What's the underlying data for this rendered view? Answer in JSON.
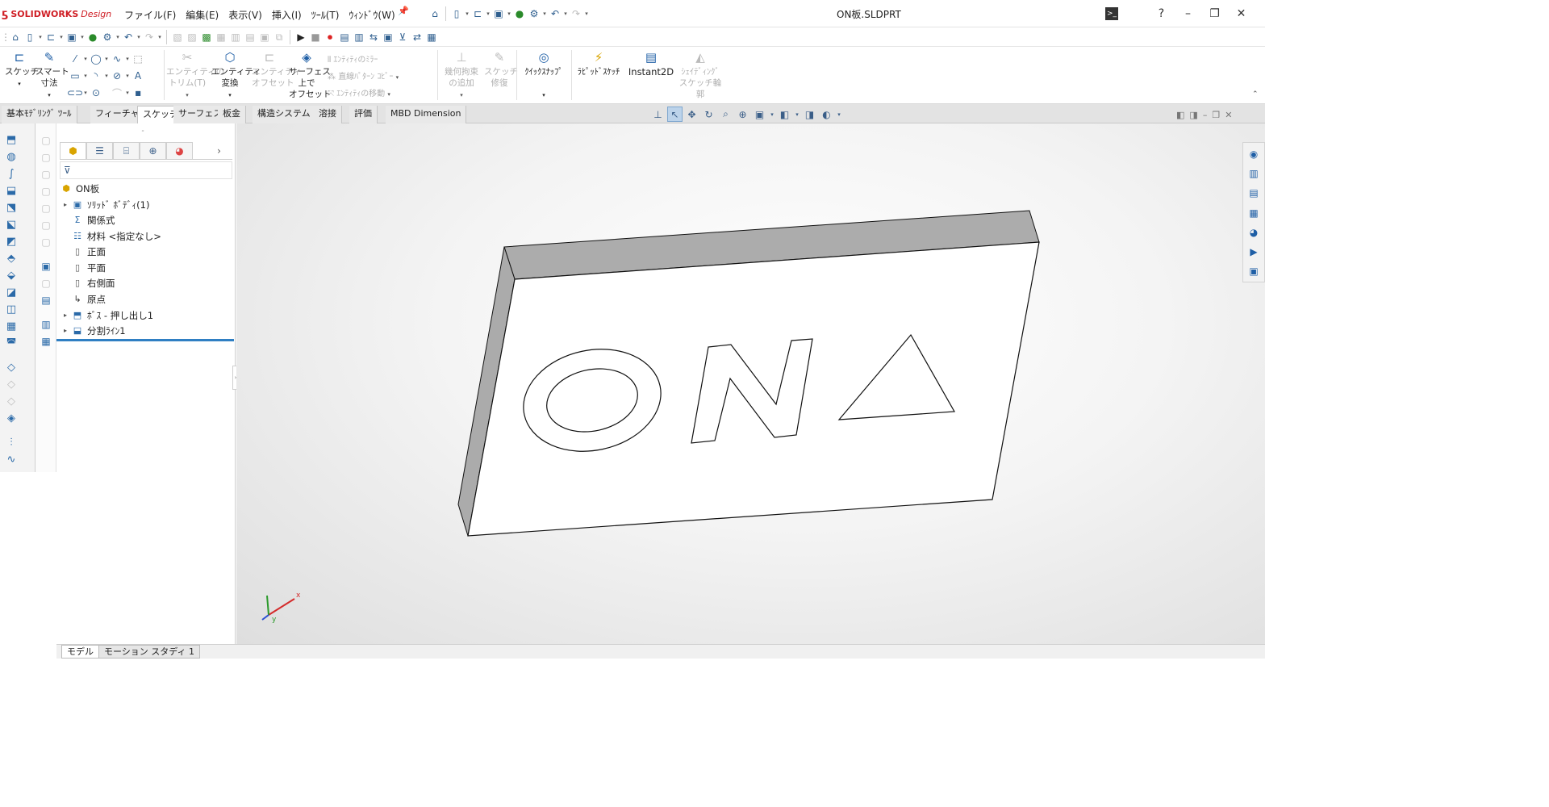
{
  "app": {
    "brand": "SOLIDWORKS",
    "brand_suffix": "Design",
    "doc_title": "ON板.SLDPRT"
  },
  "menus": [
    "ファイル(F)",
    "編集(E)",
    "表示(V)",
    "挿入(I)",
    "ﾂｰﾙ(T)",
    "ｳｨﾝﾄﾞｳ(W)"
  ],
  "ribbon": {
    "sketch": "スケッチ",
    "smart_dim_1": "スマート",
    "smart_dim_2": "寸法",
    "trim_1": "エンティティの",
    "trim_2": "トリム(T)",
    "convert_1": "エンティティ",
    "convert_2": "変換",
    "offset_1": "エンティティ",
    "offset_2": "オフセット",
    "surf_offset_1": "サーフェス",
    "surf_offset_2": "上で",
    "surf_offset_3": "オフセット",
    "mirror": "ｴﾝﾃｨﾃｨのﾐﾗｰ",
    "linear_pattern": "直線ﾊﾟﾀｰﾝ ｺﾋﾟｰ",
    "move": "ｴﾝﾃｨﾃｨの移動",
    "relation_1": "幾何拘束",
    "relation_2": "の追加",
    "repair_1": "スケッチ",
    "repair_2": "修復",
    "quick_snap": "ｸｲｯｸｽﾅｯﾌﾟ",
    "rapid_sketch": "ﾗﾋﾟｯﾄﾞｽｹｯﾁ",
    "instant2d": "Instant2D",
    "shaded_1": "ｼｪｲﾃﾞｨﾝｸﾞ",
    "shaded_2": "スケッチ輪",
    "shaded_3": "郭"
  },
  "tabs": [
    "基本ﾓﾃﾞﾘﾝｸﾞ ﾂｰﾙ",
    "フィーチャー",
    "スケッチ",
    "サーフェス",
    "板金",
    "構造システム",
    "溶接",
    "評価",
    "MBD Dimension"
  ],
  "active_tab": "スケッチ",
  "tree": {
    "root": "ON板",
    "items": [
      {
        "label": "ｿﾘｯﾄﾞ ﾎﾞﾃﾞｨ(1)",
        "expandable": true,
        "icon": "solid-bodies-icon"
      },
      {
        "label": "関係式",
        "expandable": false,
        "icon": "equations-icon"
      },
      {
        "label": "材料 <指定なし>",
        "expandable": false,
        "icon": "material-icon"
      },
      {
        "label": "正面",
        "expandable": false,
        "icon": "plane-icon"
      },
      {
        "label": "平面",
        "expandable": false,
        "icon": "plane-icon"
      },
      {
        "label": "右側面",
        "expandable": false,
        "icon": "plane-icon"
      },
      {
        "label": "原点",
        "expandable": false,
        "icon": "origin-icon"
      },
      {
        "label": "ﾎﾞｽ - 押し出し1",
        "expandable": true,
        "icon": "extrude-icon"
      },
      {
        "label": "分割ﾗｲﾝ1",
        "expandable": true,
        "icon": "split-line-icon"
      }
    ]
  },
  "triad": {
    "x_label": "x",
    "y_label": "y"
  },
  "bottom_tabs": [
    "モデル",
    "モーション スタディ 1"
  ],
  "colors": {
    "accent": "#2f7fc3",
    "brand": "#cf1d24",
    "part_face": "#ffffff",
    "part_side": "#ababab"
  }
}
